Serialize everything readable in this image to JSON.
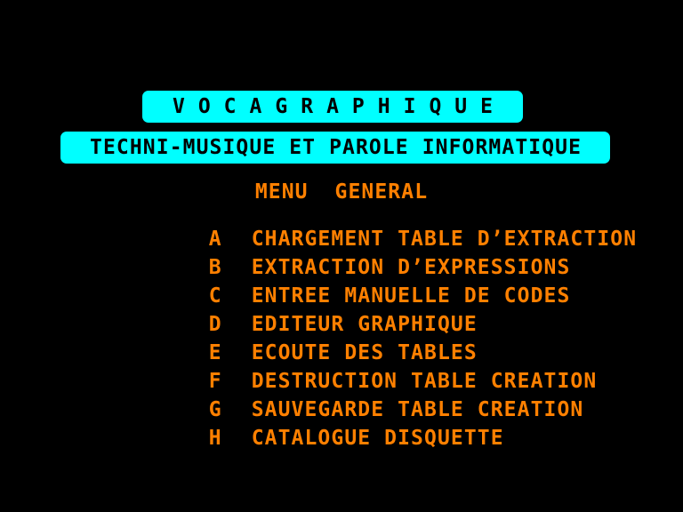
{
  "screen": {
    "background_color": "#000000",
    "accent_color": "#ff8000",
    "banner_color": "#00ffff",
    "banner_text_color": "#000000"
  },
  "banner": {
    "title": "VOCAGRAPHIQUE",
    "subtitle": "TECHNI-MUSIQUE ET PAROLE INFORMATIQUE"
  },
  "menu": {
    "heading": "MENU  GENERAL",
    "items": [
      {
        "key": "A",
        "label": "CHARGEMENT TABLE D’EXTRACTION"
      },
      {
        "key": "B",
        "label": "EXTRACTION D’EXPRESSIONS"
      },
      {
        "key": "C",
        "label": "ENTREE MANUELLE DE CODES"
      },
      {
        "key": "D",
        "label": "EDITEUR GRAPHIQUE"
      },
      {
        "key": "E",
        "label": "ECOUTE DES TABLES"
      },
      {
        "key": "F",
        "label": "DESTRUCTION TABLE CREATION"
      },
      {
        "key": "G",
        "label": "SAUVEGARDE TABLE CREATION"
      },
      {
        "key": "H",
        "label": "CATALOGUE DISQUETTE"
      }
    ]
  }
}
